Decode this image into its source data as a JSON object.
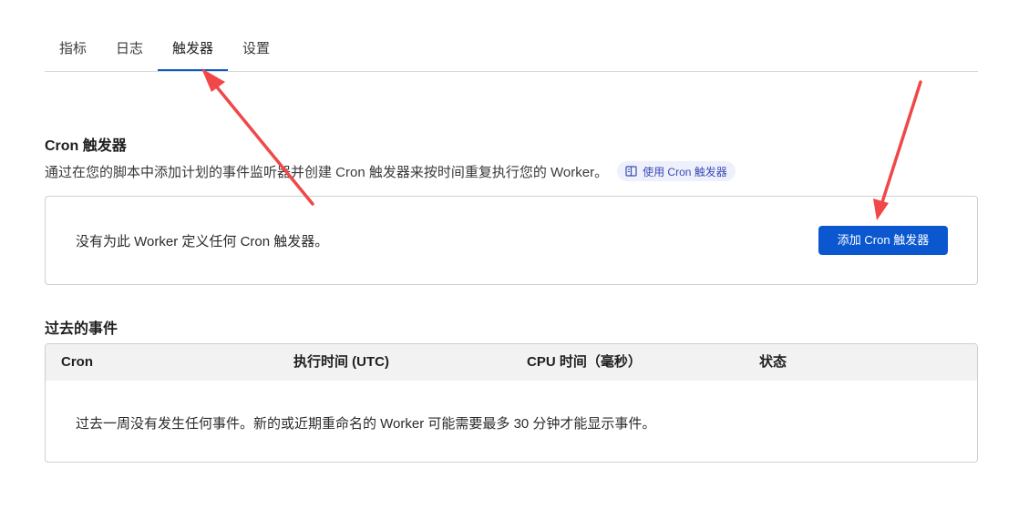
{
  "tabs": [
    {
      "label": "指标",
      "active": false
    },
    {
      "label": "日志",
      "active": false
    },
    {
      "label": "触发器",
      "active": true
    },
    {
      "label": "设置",
      "active": false
    }
  ],
  "cron": {
    "title": "Cron 触发器",
    "description": "通过在您的脚本中添加计划的事件监听器并创建 Cron 触发器来按时间重复执行您的 Worker。",
    "doc_link_label": "使用 Cron 触发器",
    "empty_message": "没有为此 Worker 定义任何 Cron 触发器。",
    "add_button_label": "添加 Cron 触发器"
  },
  "events": {
    "title": "过去的事件",
    "columns": [
      "Cron",
      "执行时间 (UTC)",
      "CPU 时间（毫秒）",
      "状态"
    ],
    "empty_message": "过去一周没有发生任何事件。新的或近期重命名的 Worker 可能需要最多 30 分钟才能显示事件。"
  },
  "colors": {
    "accent": "#0b57d0",
    "annotation_arrow": "#f04848",
    "pill_background": "#eef0fb",
    "table_header_background": "#f2f2f2"
  }
}
